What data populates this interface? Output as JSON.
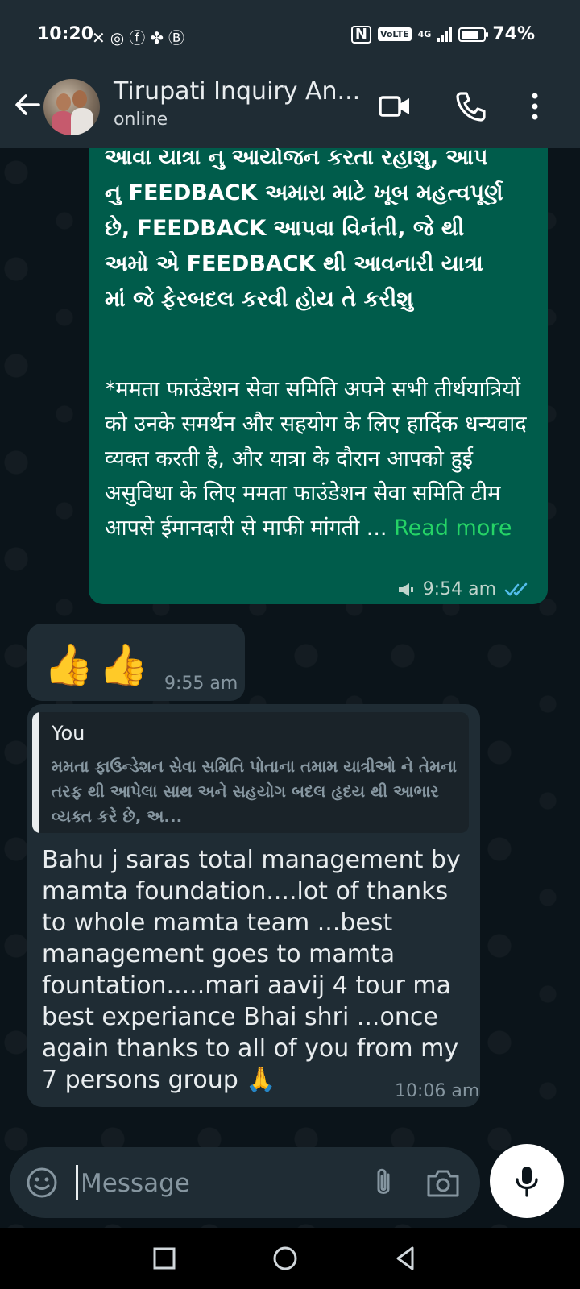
{
  "status_bar": {
    "time": "10:20",
    "battery_text": "74%",
    "battery_level": 0.74,
    "network": "4G",
    "volte": "VoLTE",
    "icons": [
      "missed-call-icon",
      "whatsapp-icon",
      "facebook-icon",
      "pinwheel-icon",
      "b-icon",
      "nfc-icon",
      "volte-icon",
      "signal-icon",
      "battery-icon"
    ]
  },
  "header": {
    "contact_name": "Tirupati Inquiry An...",
    "status": "online"
  },
  "messages": {
    "outgoing": {
      "gujarati_lines": "આવા યાત્રા નુ આયોજન કરતા રહાશુ, આપ\nનુ FEEDBACK અમારા માટે ખૂબ મહત્વપૂર્ણ\nછે, FEEDBACK આપવા વિનંતી, જે થી\nઅમો એ FEEDBACK થી આવનારી યાત્રા\nમાં જે ફેરબદલ કરવી હોય તે કરીશુ",
      "hindi_text": "*ममता फाउंडेशन सेवा समिति अपने सभी तीर्थयात्रियों को उनके समर्थन और सहयोग के लिए हार्दिक धन्यवाद व्यक्त करती है, और यात्रा के दौरान आपको हुई असुविधा के लिए ममता फाउंडेशन सेवा समिति टीम आपसे ईमानदारी से माफी मांगती ...",
      "read_more": "Read more",
      "time": "9:54 am",
      "status": "read"
    },
    "thumbs": {
      "emoji": "👍👍",
      "time": "9:55 am"
    },
    "reply": {
      "quote_author": "You",
      "quote_text": "મમતા ફાઉન્ડેશન સેવા સમિતિ પોતાના તમામ યાત્રીઓ ને તેમના તરફ થી આપેલા સાથ અને સહયોગ બદલ હૃદય થી આભાર વ્યક્ત કરે છે, અ...",
      "text": "Bahu j saras total management by mamta foundation....lot of thanks to whole mamta team ...best management goes to mamta fountation.....mari aavij 4 tour ma best experiance Bhai shri ...once again thanks to all of you from my 7 persons group 🙏",
      "time": "10:06 am"
    }
  },
  "composer": {
    "placeholder": "Message"
  },
  "colors": {
    "header_bg": "#1f2c34",
    "chat_bg": "#0b141a",
    "outgoing_bubble": "#005c4b",
    "incoming_bubble": "#1f2c34",
    "read_more": "#25d366",
    "read_ticks": "#53bdeb"
  }
}
